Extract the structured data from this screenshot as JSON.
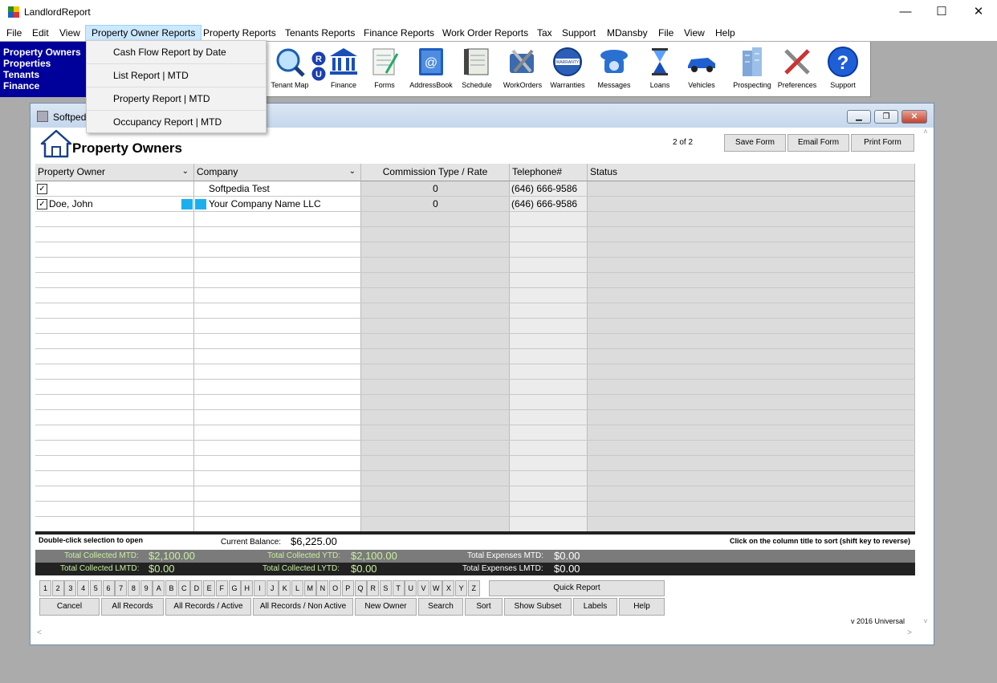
{
  "window": {
    "title": "LandlordReport",
    "min": "—",
    "max": "☐",
    "close": "✕"
  },
  "menu": [
    "File",
    "Edit",
    "View",
    "Property Owner Reports",
    "Property Reports",
    "Tenants Reports",
    "Finance Reports",
    "Work Order Reports",
    "Tax",
    "Support",
    "MDansby",
    "File",
    "View",
    "Help"
  ],
  "nav_panel": [
    "Property Owners",
    "Properties",
    "Tenants",
    "Finance"
  ],
  "toolbar": [
    "Tenant Map",
    "Finance",
    "Forms",
    "AddressBook",
    "Schedule",
    "WorkOrders",
    "Warranties",
    "Messages",
    "Loans",
    "Vehicles",
    "Prospecting",
    "Preferences",
    "Support"
  ],
  "dropdown": [
    "Cash Flow Report by Date",
    "List Report | MTD",
    "Property Report | MTD",
    "Occupancy Report | MTD"
  ],
  "child_window": {
    "title": "Softped",
    "form_title": "Property Owners",
    "pager": "2  of  2",
    "save_form": "Save Form",
    "email_form": "Email Form",
    "print_form": "Print Form"
  },
  "grid": {
    "headers": [
      "Property Owner",
      "Company",
      "Commission Type / Rate",
      "Telephone#",
      "Status"
    ],
    "rows": [
      {
        "owner": "",
        "company": "Softpedia Test",
        "commission": "0",
        "phone": "(646) 666-9586",
        "status": ""
      },
      {
        "owner": "Doe, John",
        "company": "Your Company Name LLC",
        "commission": "0",
        "phone": "(646) 666-9586",
        "status": ""
      }
    ]
  },
  "footer": {
    "hint_left": "Double-click selection to open",
    "current_balance_label": "Current Balance:",
    "current_balance": "$6,225.00",
    "hint_right": "Click on the column title to sort (shift key to reverse)",
    "tc_mtd_label": "Total Collected MTD:",
    "tc_mtd": "$2,100.00",
    "tc_ytd_label": "Total Collected YTD:",
    "tc_ytd": "$2,100.00",
    "te_mtd_label": "Total Expenses MTD:",
    "te_mtd": "$0.00",
    "tc_lmtd_label": "Total Collected LMTD:",
    "tc_lmtd": "$0.00",
    "tc_lytd_label": "Total Collected LYTD:",
    "tc_lytd": "$0.00",
    "te_lmtd_label": "Total Expenses LMTD:",
    "te_lmtd": "$0.00"
  },
  "alpha": [
    "1",
    "2",
    "3",
    "4",
    "5",
    "6",
    "7",
    "8",
    "9",
    "A",
    "B",
    "C",
    "D",
    "E",
    "F",
    "G",
    "H",
    "I",
    "J",
    "K",
    "L",
    "M",
    "N",
    "O",
    "P",
    "Q",
    "R",
    "S",
    "T",
    "U",
    "V",
    "W",
    "X",
    "Y",
    "Z"
  ],
  "quick_report": "Quick Report",
  "buttons": [
    "Cancel",
    "All Records",
    "All Records / Active",
    "All Records / Non Active",
    "New Owner",
    "Search",
    "Sort",
    "Show Subset",
    "Labels",
    "Help"
  ],
  "version": "v 2016 Universal"
}
